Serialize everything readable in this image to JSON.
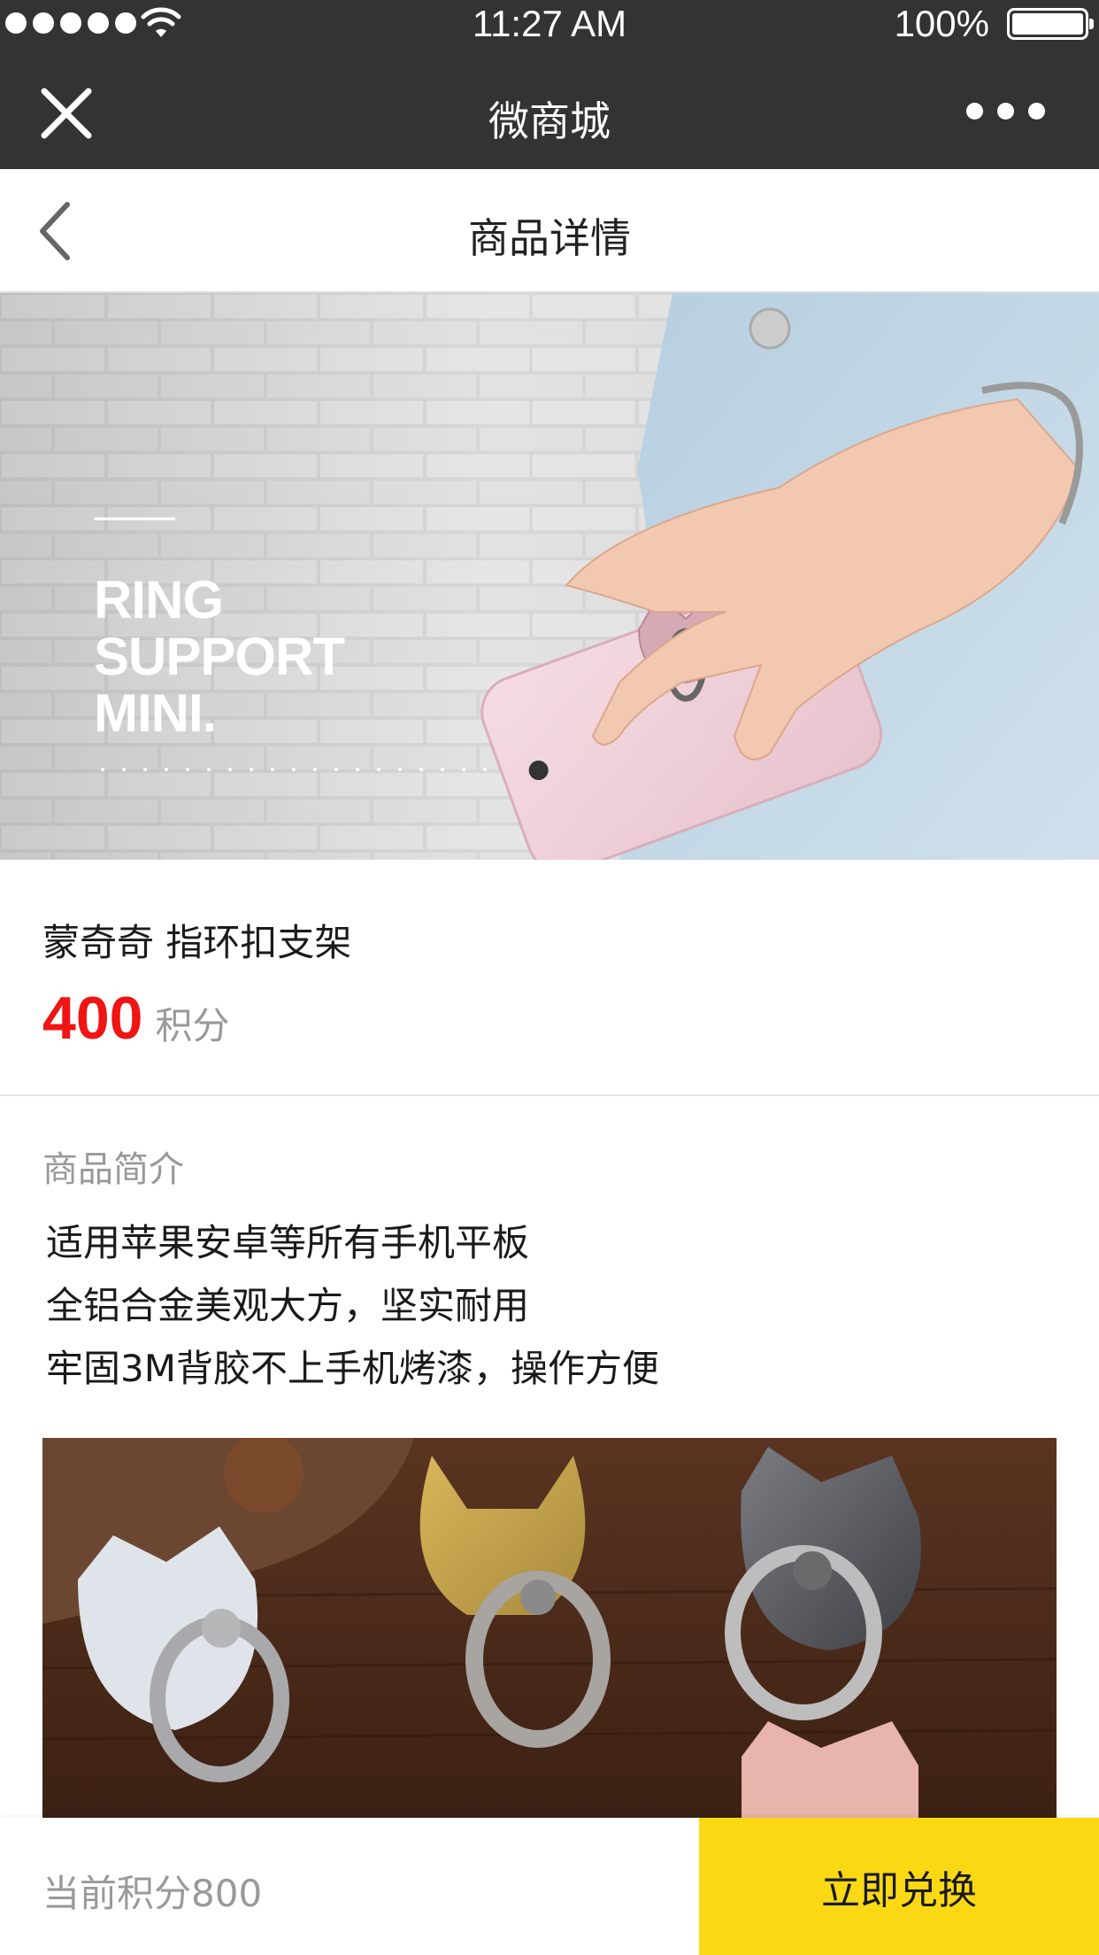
{
  "status_bar": {
    "time": "11:27 AM",
    "battery": "100%",
    "signal_icon": "signal-dots-icon",
    "wifi_icon": "wifi-icon",
    "battery_icon": "battery-icon"
  },
  "wechat_bar": {
    "title": "微商城",
    "close_icon": "close-icon",
    "more_icon": "more-dots-icon"
  },
  "page_header": {
    "title": "商品详情",
    "back_icon": "chevron-left-icon"
  },
  "hero": {
    "lines": [
      "RING",
      "SUPPORT",
      "MINI."
    ]
  },
  "product": {
    "name": "蒙奇奇 指环扣支架",
    "price": "400",
    "price_unit": "积分"
  },
  "description": {
    "title": "商品简介",
    "lines": [
      "适用苹果安卓等所有手机平板",
      "全铝合金美观大方，坚实耐用",
      "牢固3M背胶不上手机烤漆，操作方便"
    ]
  },
  "footer": {
    "points_label": "当前积分800",
    "redeem_label": "立即兑换"
  },
  "colors": {
    "bar_background": "#333333",
    "price_red": "#f01414",
    "redeem_yellow": "#fad914",
    "muted_gray": "#999999"
  }
}
